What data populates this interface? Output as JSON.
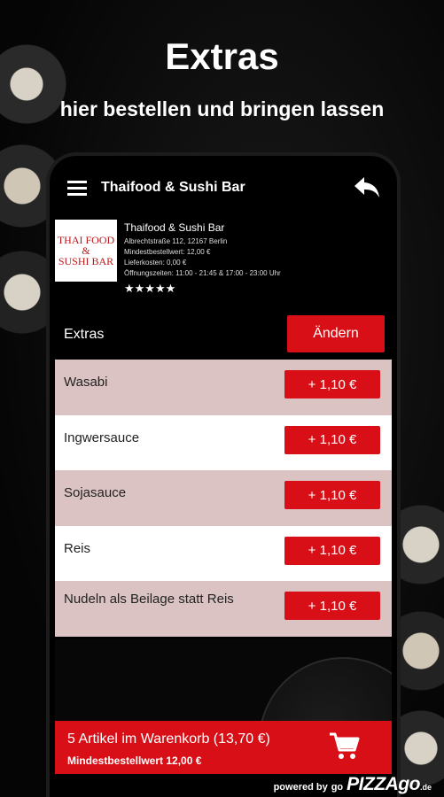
{
  "promo": {
    "headline": "Extras",
    "subline": "hier bestellen und bringen lassen"
  },
  "appbar": {
    "title": "Thaifood & Sushi Bar"
  },
  "restaurant": {
    "logo_line1": "THAI FOOD",
    "logo_line2": "&",
    "logo_line3": "SUSHI BAR",
    "name": "Thaifood & Sushi Bar",
    "address": "Albrechtstraße 112, 12167 Berlin",
    "min_order": "Mindestbestellwert: 12,00 €",
    "delivery_cost": "Lieferkosten: 0,00 €",
    "opening_hours": "Öffnungszeiten: 11:00 - 21:45 & 17:00 - 23:00 Uhr",
    "stars": "★★★★★"
  },
  "section": {
    "title": "Extras",
    "change_label": "Ändern"
  },
  "extras": [
    {
      "name": "Wasabi",
      "price": "+ 1,10 €"
    },
    {
      "name": "Ingwersauce",
      "price": "+ 1,10 €"
    },
    {
      "name": "Sojasauce",
      "price": "+ 1,10 €"
    },
    {
      "name": "Reis",
      "price": "+ 1,10 €"
    },
    {
      "name": "Nudeln als Beilage statt Reis",
      "price": "+ 1,10 €"
    }
  ],
  "cart": {
    "summary": "5 Artikel im Warenkorb (13,70 €)",
    "min_order": "Mindestbestellwert 12,00 €"
  },
  "footer": {
    "powered_by": "powered by",
    "brand_prefix": "go",
    "brand": "PIZZAgo",
    "tld": ".de"
  },
  "colors": {
    "accent": "#d80f16",
    "row_tint": "#dcc3c3"
  },
  "icons": {
    "menu": "hamburger-menu-icon",
    "back": "reply-arrow-icon",
    "cart": "shopping-cart-icon"
  }
}
